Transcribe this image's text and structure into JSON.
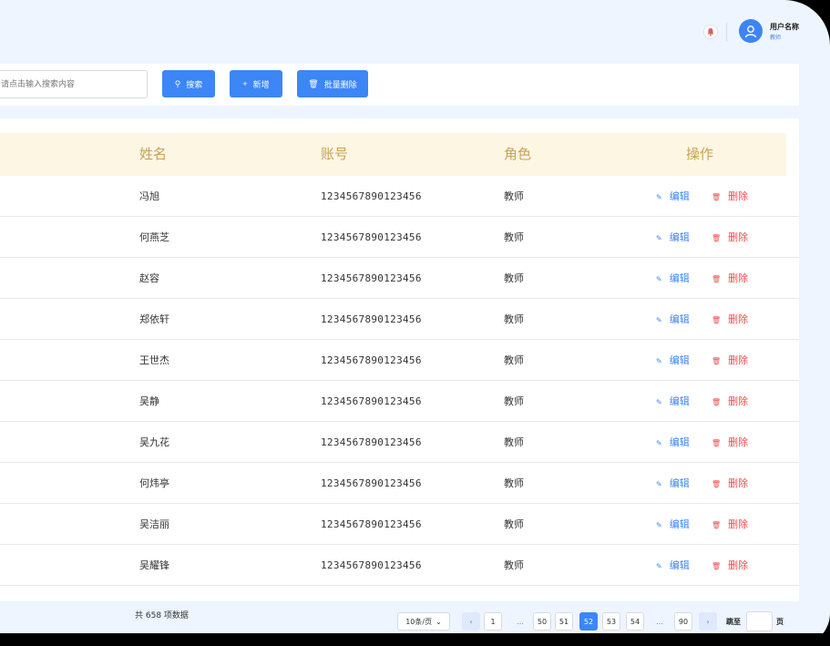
{
  "header": {
    "user_name": "用户名称",
    "user_role": "教师",
    "bell_icon": "bell-icon",
    "avatar_icon": "user-avatar-icon"
  },
  "toolbar": {
    "search_placeholder": "请点击输入搜索内容",
    "search_label": "搜索",
    "add_label": "新增",
    "batch_delete_label": "批量删除"
  },
  "table": {
    "columns": [
      "姓名",
      "账号",
      "角色",
      "操作"
    ],
    "rows": [
      {
        "name": "冯旭",
        "account": "1234567890123456",
        "role": "教师"
      },
      {
        "name": "何燕芝",
        "account": "1234567890123456",
        "role": "教师"
      },
      {
        "name": "赵容",
        "account": "1234567890123456",
        "role": "教师"
      },
      {
        "name": "郑依轩",
        "account": "1234567890123456",
        "role": "教师"
      },
      {
        "name": "王世杰",
        "account": "1234567890123456",
        "role": "教师"
      },
      {
        "name": "吴静",
        "account": "1234567890123456",
        "role": "教师"
      },
      {
        "name": "吴九花",
        "account": "1234567890123456",
        "role": "教师"
      },
      {
        "name": "何炜亭",
        "account": "1234567890123456",
        "role": "教师"
      },
      {
        "name": "吴洁丽",
        "account": "1234567890123456",
        "role": "教师"
      },
      {
        "name": "吴耀锋",
        "account": "1234567890123456",
        "role": "教师"
      }
    ],
    "edit_label": "编辑",
    "delete_label": "删除"
  },
  "pagination": {
    "total_text": "共 658 项数据",
    "page_size": "10条/页",
    "pages": [
      "1",
      "…",
      "50",
      "51",
      "52",
      "53",
      "54",
      "…",
      "90"
    ],
    "current": "52",
    "jump_label": "跳至",
    "jump_unit": "页"
  },
  "colors": {
    "primary": "#3d86f6",
    "danger": "#ef4d4d",
    "header_text": "#c9a255",
    "header_bg": "#fdf6e3",
    "page_bg": "#eef5fe"
  }
}
